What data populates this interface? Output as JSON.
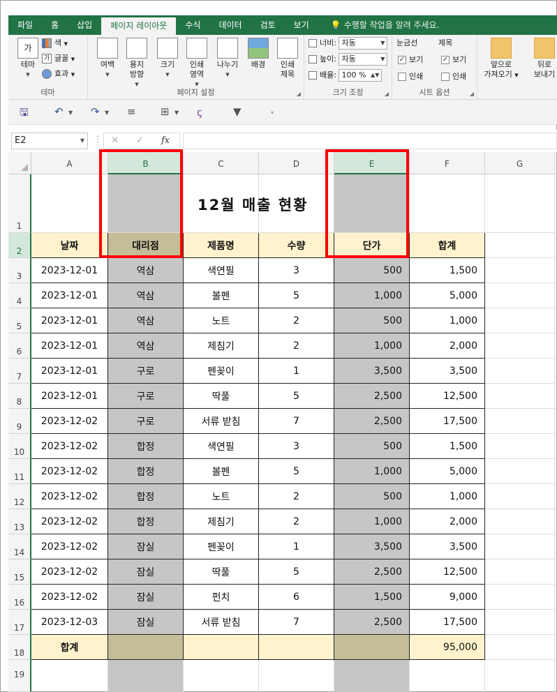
{
  "ribbon_tabs": [
    "파일",
    "홈",
    "삽입",
    "페이지 레이아웃",
    "수식",
    "데이터",
    "검토",
    "보기"
  ],
  "active_tab_index": 3,
  "tell_me": "수행할 작업을 알려 주세요.",
  "ribbon": {
    "theme_group": {
      "label": "테마",
      "theme_btn": "테마",
      "colors": "색",
      "fonts": "글꼴",
      "effects": "효과"
    },
    "page_setup_group": {
      "label": "페이지 설정",
      "buttons": [
        {
          "line1": "여백",
          "line2": ""
        },
        {
          "line1": "용지",
          "line2": "방향"
        },
        {
          "line1": "크기",
          "line2": ""
        },
        {
          "line1": "인쇄",
          "line2": "영역"
        },
        {
          "line1": "나누기",
          "line2": ""
        },
        {
          "line1": "배경",
          "line2": ""
        },
        {
          "line1": "인쇄",
          "line2": "제목"
        }
      ]
    },
    "scale_group": {
      "label": "크기 조정",
      "width_label": "너비:",
      "width_value": "자동",
      "height_label": "높이:",
      "height_value": "자동",
      "scale_label": "배율:",
      "scale_value": "100 %"
    },
    "sheet_options_group": {
      "label": "시트 옵션",
      "gridlines": "눈금선",
      "headings": "제목",
      "view": "보기",
      "print": "인쇄"
    },
    "arrange_group": {
      "bring_forward_1": "앞으로",
      "bring_forward_2": "가져오기",
      "send_backward_1": "뒤로",
      "send_backward_2": "보내기"
    }
  },
  "name_box": "E2",
  "formula_value": "",
  "columns": [
    "A",
    "B",
    "C",
    "D",
    "E",
    "F",
    "G"
  ],
  "title": "12월 매출 현황",
  "headers": [
    "날짜",
    "대리점",
    "제품명",
    "수량",
    "단가",
    "합계"
  ],
  "rows": [
    {
      "n": "3",
      "date": "2023-12-01",
      "branch": "역삼",
      "product": "색연필",
      "qty": "3",
      "price": "500",
      "total": "1,500"
    },
    {
      "n": "4",
      "date": "2023-12-01",
      "branch": "역삼",
      "product": "볼펜",
      "qty": "5",
      "price": "1,000",
      "total": "5,000"
    },
    {
      "n": "5",
      "date": "2023-12-01",
      "branch": "역삼",
      "product": "노트",
      "qty": "2",
      "price": "500",
      "total": "1,000"
    },
    {
      "n": "6",
      "date": "2023-12-01",
      "branch": "역삼",
      "product": "제침기",
      "qty": "2",
      "price": "1,000",
      "total": "2,000"
    },
    {
      "n": "7",
      "date": "2023-12-01",
      "branch": "구로",
      "product": "펜꽂이",
      "qty": "1",
      "price": "3,500",
      "total": "3,500"
    },
    {
      "n": "8",
      "date": "2023-12-01",
      "branch": "구로",
      "product": "딱풀",
      "qty": "5",
      "price": "2,500",
      "total": "12,500"
    },
    {
      "n": "9",
      "date": "2023-12-02",
      "branch": "구로",
      "product": "서류 받침",
      "qty": "7",
      "price": "2,500",
      "total": "17,500"
    },
    {
      "n": "10",
      "date": "2023-12-02",
      "branch": "합정",
      "product": "색연필",
      "qty": "3",
      "price": "500",
      "total": "1,500"
    },
    {
      "n": "11",
      "date": "2023-12-02",
      "branch": "합정",
      "product": "볼펜",
      "qty": "5",
      "price": "1,000",
      "total": "5,000"
    },
    {
      "n": "12",
      "date": "2023-12-02",
      "branch": "합정",
      "product": "노트",
      "qty": "2",
      "price": "500",
      "total": "1,000"
    },
    {
      "n": "13",
      "date": "2023-12-02",
      "branch": "합정",
      "product": "제침기",
      "qty": "2",
      "price": "1,000",
      "total": "2,000"
    },
    {
      "n": "14",
      "date": "2023-12-02",
      "branch": "잠실",
      "product": "펜꽂이",
      "qty": "1",
      "price": "3,500",
      "total": "3,500"
    },
    {
      "n": "15",
      "date": "2023-12-02",
      "branch": "잠실",
      "product": "딱풀",
      "qty": "5",
      "price": "2,500",
      "total": "12,500"
    },
    {
      "n": "16",
      "date": "2023-12-02",
      "branch": "잠실",
      "product": "펀치",
      "qty": "6",
      "price": "1,500",
      "total": "9,000"
    },
    {
      "n": "17",
      "date": "2023-12-03",
      "branch": "잠실",
      "product": "서류 받침",
      "qty": "7",
      "price": "2,500",
      "total": "17,500"
    }
  ],
  "total_row": {
    "n": "18",
    "label": "합계",
    "total": "95,000"
  },
  "row_numbers": {
    "title_row": "1",
    "header_row": "2",
    "empty_row": "19"
  },
  "colors": {
    "excel_green": "#217346",
    "header_fill": "#fff2cc",
    "gray_fill": "#c6c6c6",
    "selected_header_fill": "#c4bd97",
    "highlight_red": "#ff0000"
  },
  "icons": [
    "save-icon",
    "undo-icon",
    "redo-icon",
    "align-icon",
    "borders-icon",
    "clear-format-icon",
    "filter-icon",
    "lightbulb-icon"
  ]
}
